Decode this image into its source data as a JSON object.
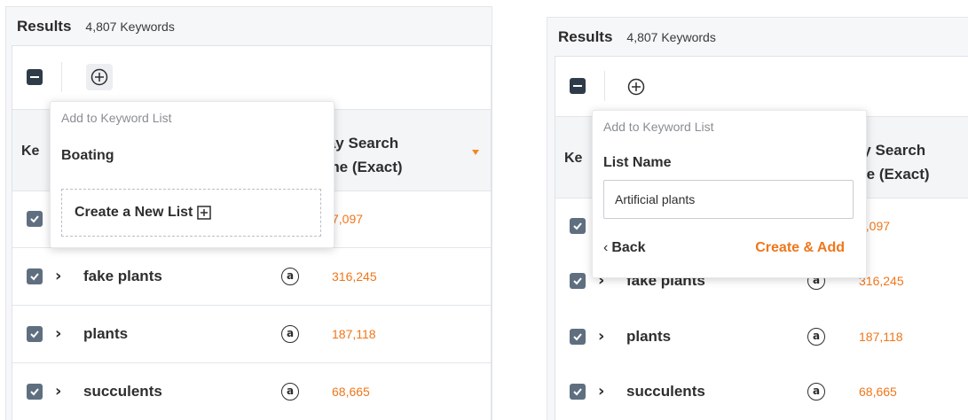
{
  "left": {
    "results_title": "Results",
    "results_count": "4,807 Keywords",
    "header": {
      "keyword_label": "Ke",
      "volume_label": "30-Day Search\nVolume (Exact)"
    },
    "popup": {
      "caption": "Add to Keyword List",
      "list_item": "Boating",
      "create_new_label": "Create a New List"
    },
    "rows": [
      {
        "keyword": "",
        "volume": "7,097"
      },
      {
        "keyword": "fake plants",
        "volume": "316,245"
      },
      {
        "keyword": "plants",
        "volume": "187,118"
      },
      {
        "keyword": "succulents",
        "volume": "68,665"
      }
    ]
  },
  "right": {
    "results_title": "Results",
    "results_count": "4,807 Keywords",
    "header": {
      "keyword_label": "Ke",
      "volume_label": "30-Day Search\nVolume (Exact)"
    },
    "popup": {
      "caption": "Add to Keyword List",
      "field_label": "List Name",
      "input_value": "Artificial plants",
      "back_label": "Back",
      "create_add_label": "Create & Add"
    },
    "rows": [
      {
        "keyword": "",
        "volume": "7,097"
      },
      {
        "keyword": "fake plants",
        "volume": "316,245"
      },
      {
        "keyword": "plants",
        "volume": "187,118"
      },
      {
        "keyword": "succulents",
        "volume": "68,665"
      }
    ]
  },
  "icons": {
    "chevron": "chevron-right-icon",
    "amazon": "amazon-icon",
    "add": "add-circle-icon"
  },
  "colors": {
    "accent": "#f0761a",
    "checkbox": "#5f6f80",
    "dark": "#2f3b48"
  }
}
